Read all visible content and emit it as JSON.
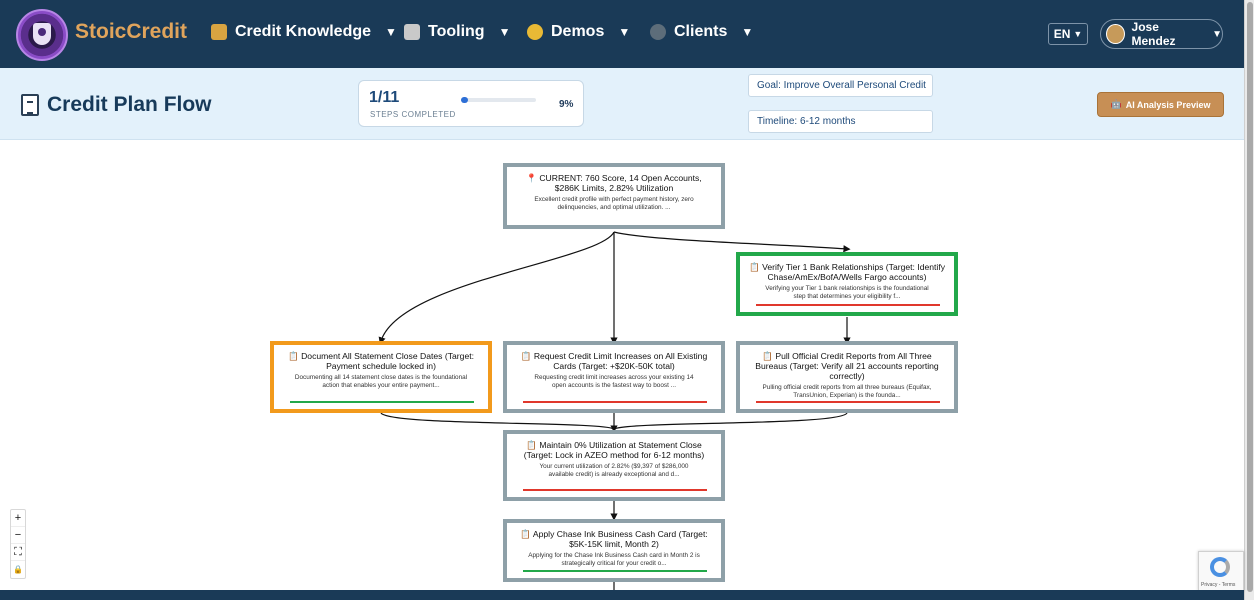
{
  "app": {
    "brand": "StoicCredit",
    "nav": [
      {
        "label": "Credit Knowledge",
        "icon": "books-icon"
      },
      {
        "label": "Tooling",
        "icon": "tools-icon"
      },
      {
        "label": "Demos",
        "icon": "theater-masks-icon"
      },
      {
        "label": "Clients",
        "icon": "people-icon"
      }
    ],
    "language": "EN",
    "user_name": "Jose Mendez",
    "caret": "▼"
  },
  "header": {
    "title": "Credit Plan Flow",
    "progress": {
      "count": "1/11",
      "caption": "STEPS COMPLETED",
      "percent_label": "9%",
      "fraction": 0.09
    },
    "goal": "Goal: Improve Overall Personal Credit",
    "timeline": "Timeline: 6-12 months",
    "ai_button": "AI Analysis Preview"
  },
  "colors": {
    "status_red": "#e0382c",
    "status_green": "#22a84a",
    "highlight_orange": "#f29a1c",
    "accent_brown": "#c78f55"
  },
  "flow": {
    "nodes": [
      {
        "id": "current",
        "title": "📍 CURRENT: 760 Score, 14 Open Accounts, $286K Limits, 2.82% Utilization",
        "desc": "Excellent credit profile with perfect payment history, zero delinquencies, and optimal utilization. ..."
      },
      {
        "id": "verify",
        "title": "📋 Verify Tier 1 Bank Relationships (Target: Identify Chase/AmEx/BofA/Wells Fargo accounts)",
        "desc": "Verifying your Tier 1 bank relationships is the foundational step that determines your eligibility f..."
      },
      {
        "id": "statement",
        "title": "📋 Document All Statement Close Dates (Target: Payment schedule locked in)",
        "desc": "Documenting all 14 statement close dates is the foundational action that enables your entire payment..."
      },
      {
        "id": "limits",
        "title": "📋 Request Credit Limit Increases on All Existing Cards (Target: +$20K-50K total)",
        "desc": "Requesting credit limit increases across your existing 14 open accounts is the fastest way to boost ..."
      },
      {
        "id": "reports",
        "title": "📋 Pull Official Credit Reports from All Three Bureaus (Target: Verify all 21 accounts reporting correctly)",
        "desc": "Pulling official credit reports from all three bureaus (Equifax, TransUnion, Experian) is the founda..."
      },
      {
        "id": "azeo",
        "title": "📋 Maintain 0% Utilization at Statement Close (Target: Lock in AZEO method for 6-12 months)",
        "desc": "Your current utilization of 2.82% ($9,397 of $286,000 available credit) is already exceptional and d..."
      },
      {
        "id": "ink",
        "title": "📋 Apply Chase Ink Business Cash Card (Target: $5K-15K limit, Month 2)",
        "desc": "Applying for the Chase Ink Business Cash card in Month 2 is strategically critical for your credit o..."
      }
    ]
  },
  "controls": {
    "zoom_in": "+",
    "zoom_out": "−",
    "fit": "⛶",
    "lock": "🔒"
  },
  "recaptcha": {
    "text": "Privacy - Terms"
  }
}
